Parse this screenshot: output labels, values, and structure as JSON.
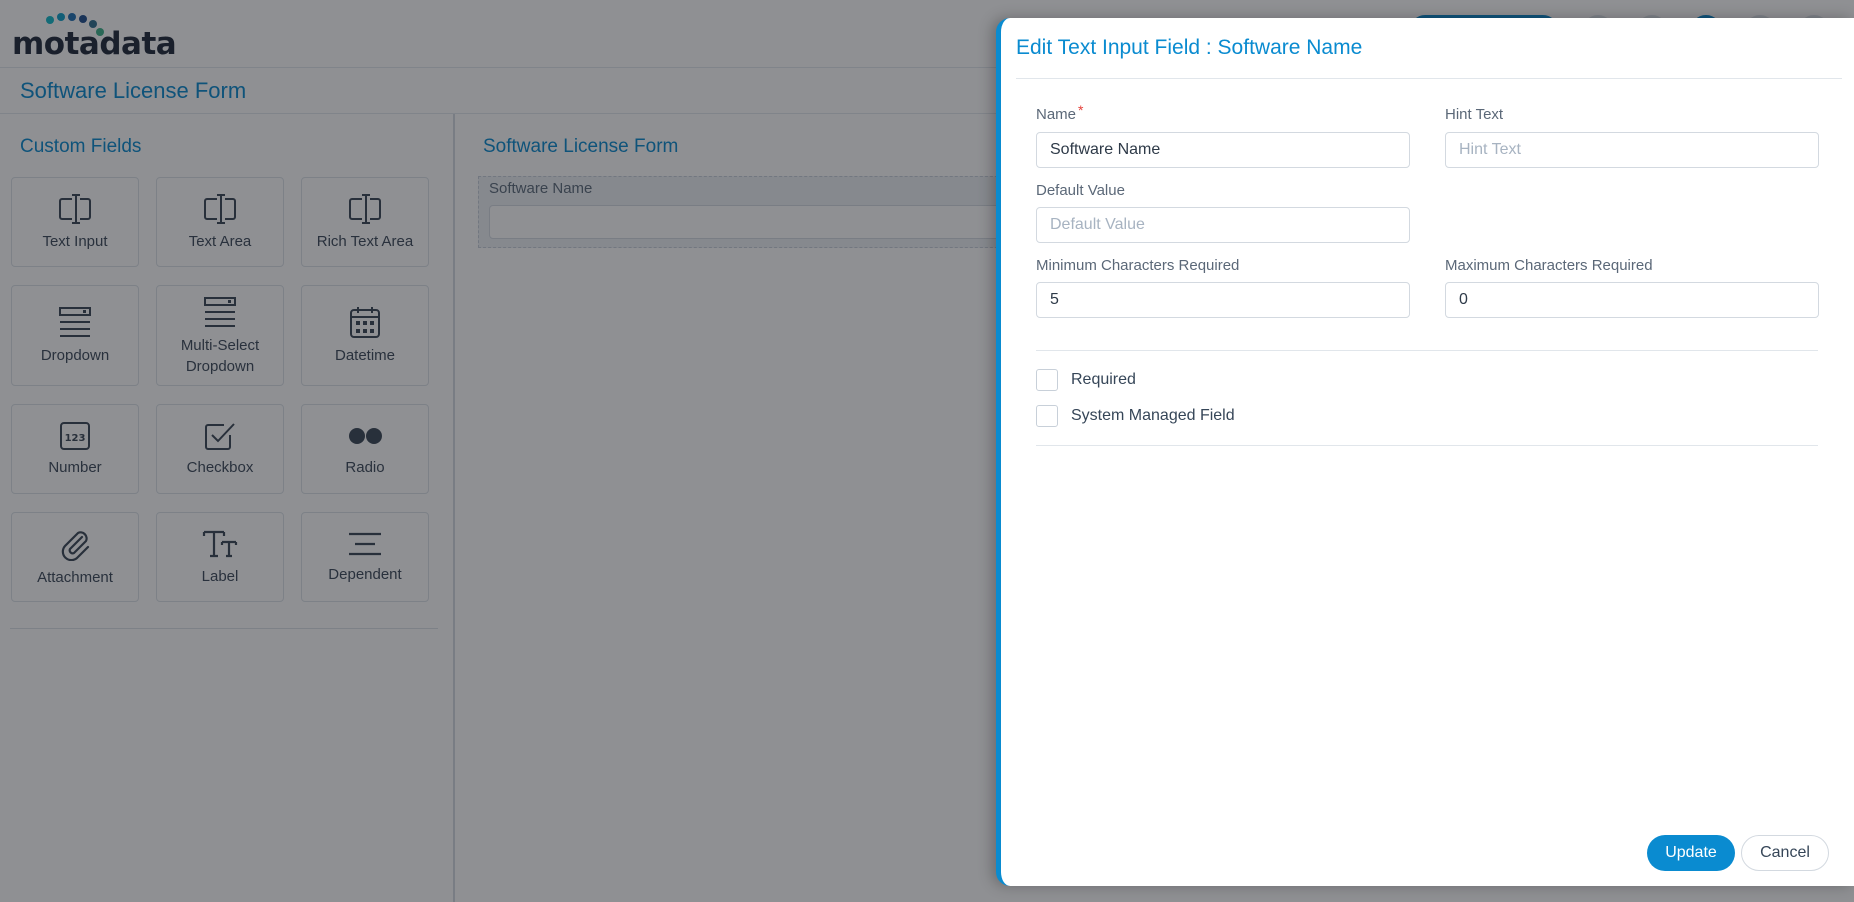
{
  "app": {
    "logo_text": "motadata",
    "page_title": "Software License Form"
  },
  "custom_fields": {
    "heading": "Custom Fields",
    "tiles": [
      {
        "label": "Text Input",
        "icon": "text-cursor-icon"
      },
      {
        "label": "Text Area",
        "icon": "text-cursor-icon"
      },
      {
        "label": "Rich Text Area",
        "icon": "text-cursor-icon"
      },
      {
        "label": "Dropdown",
        "icon": "dropdown-icon"
      },
      {
        "label": "Multi-Select Dropdown",
        "icon": "multi-select-icon"
      },
      {
        "label": "Datetime",
        "icon": "calendar-icon"
      },
      {
        "label": "Number",
        "icon": "number-icon"
      },
      {
        "label": "Checkbox",
        "icon": "checkbox-icon"
      },
      {
        "label": "Radio",
        "icon": "radio-icon"
      },
      {
        "label": "Attachment",
        "icon": "paperclip-icon"
      },
      {
        "label": "Label",
        "icon": "text-size-icon"
      },
      {
        "label": "Dependent",
        "icon": "lines-icon"
      }
    ]
  },
  "form_canvas": {
    "heading": "Software License Form",
    "field_label": "Software Name"
  },
  "drawer": {
    "title": "Edit Text Input Field : Software Name",
    "name_label": "Name",
    "name_value": "Software Name",
    "hint_label": "Hint Text",
    "hint_placeholder": "Hint Text",
    "default_label": "Default Value",
    "default_placeholder": "Default Value",
    "min_label": "Minimum Characters Required",
    "min_value": "5",
    "max_label": "Maximum Characters Required",
    "max_value": "0",
    "required_label": "Required",
    "system_managed_label": "System Managed Field",
    "update_label": "Update",
    "cancel_label": "Cancel"
  },
  "colors": {
    "accent": "#0a8bd0",
    "required_star": "#e5413a"
  }
}
